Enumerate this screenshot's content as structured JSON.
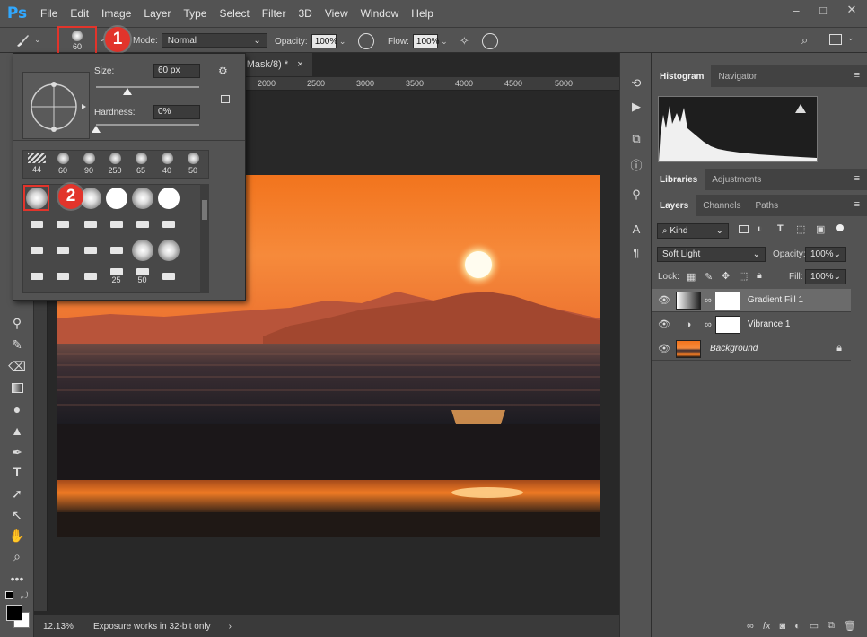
{
  "app": {
    "logo": "Ps"
  },
  "menu": [
    "File",
    "Edit",
    "Image",
    "Layer",
    "Type",
    "Select",
    "Filter",
    "3D",
    "View",
    "Window",
    "Help"
  ],
  "window_controls": [
    "–",
    "□",
    "✕"
  ],
  "options": {
    "brush_size_label": "60",
    "mode_label": "Mode:",
    "mode_value": "Normal",
    "opacity_label": "Opacity:",
    "opacity_value": "100%",
    "flow_label": "Flow:",
    "flow_value": "100%"
  },
  "callouts": {
    "one": "1",
    "two": "2"
  },
  "doc": {
    "tab_title": "r Mask/8) *",
    "tab_close": "×",
    "ruler_ticks": [
      "2000",
      "2500",
      "3000",
      "3500",
      "4000",
      "4500",
      "5000"
    ],
    "zoom": "12.13%",
    "status": "Exposure works in 32-bit only"
  },
  "brush_popup": {
    "size_label": "Size:",
    "size_value": "60 px",
    "hardness_label": "Hardness:",
    "hardness_value": "0%",
    "size_fraction": 0.3,
    "hardness_fraction": 0.0,
    "recent_sizes": [
      "44",
      "60",
      "90",
      "250",
      "65",
      "40",
      "50"
    ],
    "grid_labels": [
      "25",
      "50"
    ]
  },
  "panels": {
    "top_tabs": [
      "Histogram",
      "Navigator"
    ],
    "mid_tabs": [
      "Libraries",
      "Adjustments"
    ],
    "layer_tabs": [
      "Layers",
      "Channels",
      "Paths"
    ],
    "kind_label": "Kind",
    "blend_mode": "Soft Light",
    "opacity_label": "Opacity:",
    "opacity_value": "100%",
    "lock_label": "Lock:",
    "fill_label": "Fill:",
    "fill_value": "100%",
    "layers": [
      {
        "name": "Gradient Fill 1",
        "selected": true
      },
      {
        "name": "Vibrance 1",
        "selected": false
      },
      {
        "name": "Background",
        "selected": false
      }
    ]
  },
  "colors": {
    "accent": "#e2342b",
    "ps_blue": "#31a8ff"
  }
}
